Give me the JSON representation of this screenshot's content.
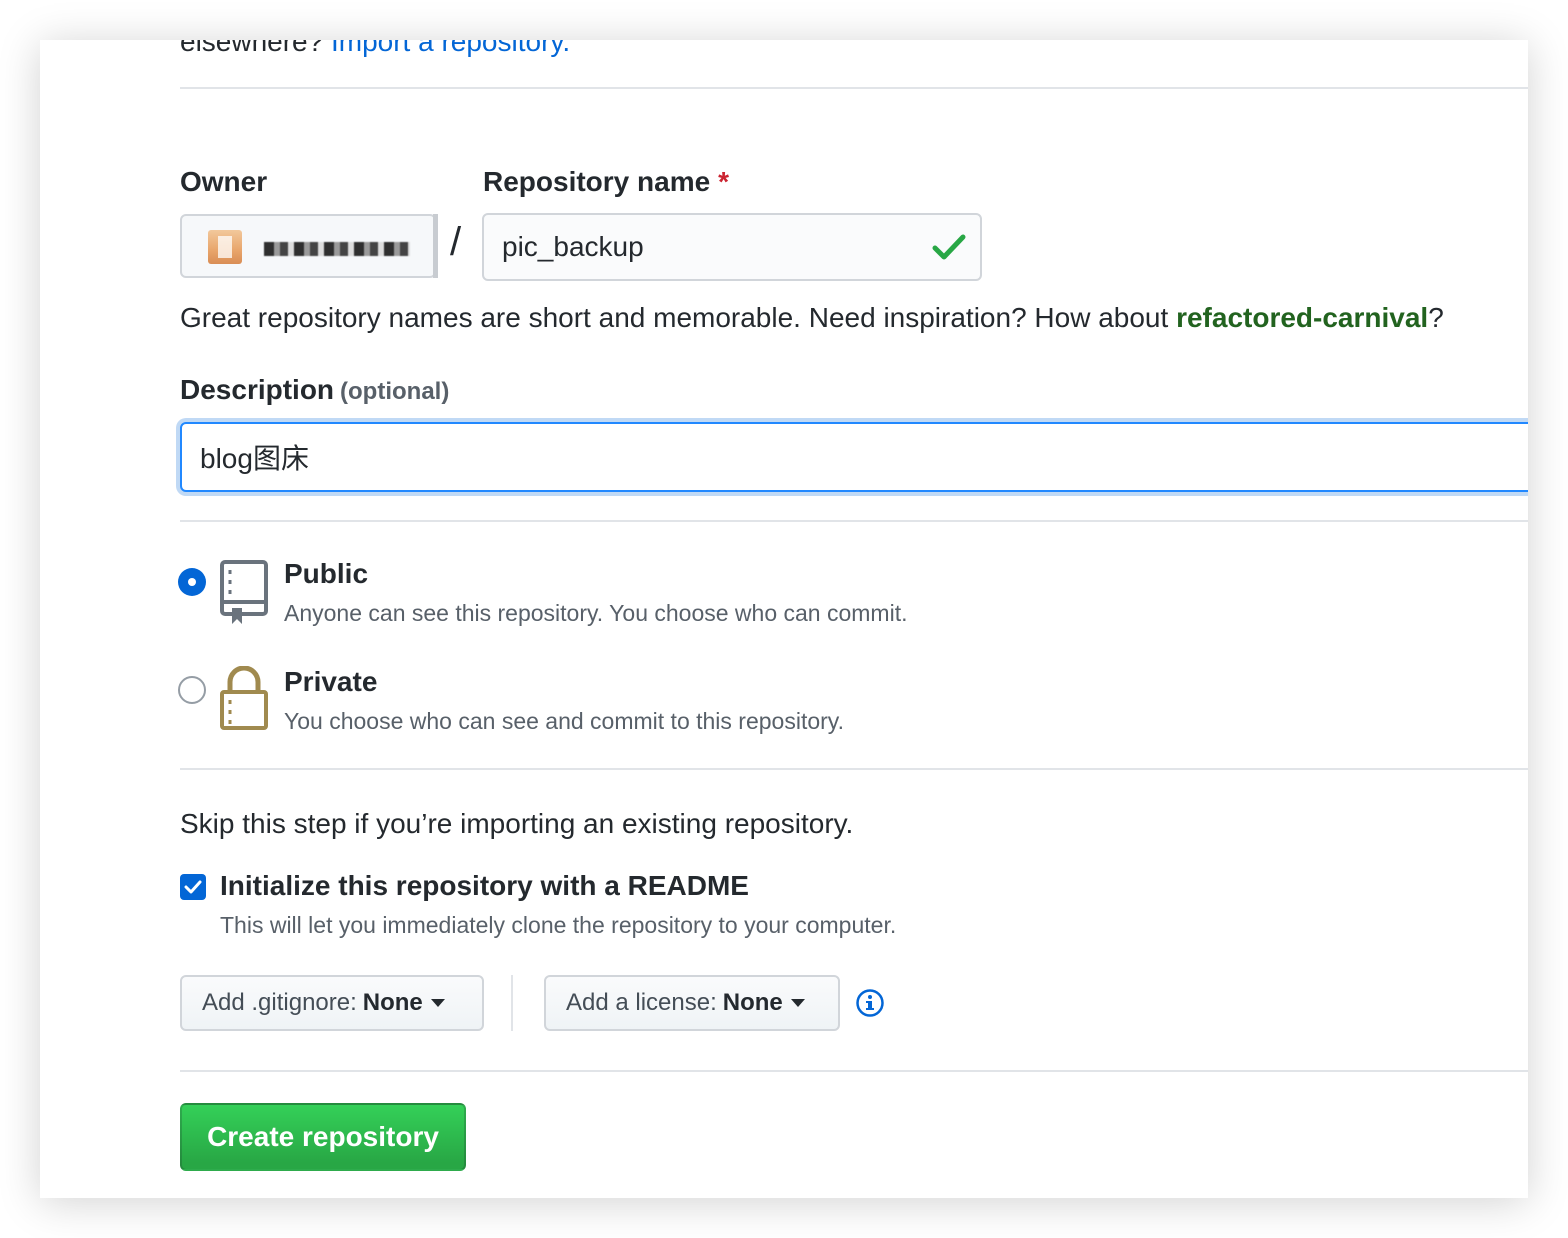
{
  "top_note": {
    "prefix": "elsewhere?",
    "link": "Import a repository."
  },
  "owner": {
    "label": "Owner",
    "username": "(blurred)"
  },
  "repo_name": {
    "label": "Repository name",
    "required_mark": "*",
    "value": "pic_backup"
  },
  "name_hint": {
    "text": "Great repository names are short and memorable. Need inspiration? How about ",
    "suggestion": "refactored-carnival",
    "suffix": "?"
  },
  "description": {
    "label": "Description",
    "optional": "(optional)",
    "value": "blog图床"
  },
  "visibility": {
    "public": {
      "title": "Public",
      "desc": "Anyone can see this repository. You choose who can commit.",
      "selected": true
    },
    "private": {
      "title": "Private",
      "desc": "You choose who can see and commit to this repository.",
      "selected": false
    }
  },
  "init": {
    "skip_text": "Skip this step if you’re importing an existing repository.",
    "readme_title": "Initialize this repository with a README",
    "readme_desc": "This will let you immediately clone the repository to your computer.",
    "readme_checked": true
  },
  "gitignore": {
    "prefix": "Add .gitignore:",
    "value": "None"
  },
  "license": {
    "prefix": "Add a license:",
    "value": "None"
  },
  "create_button": "Create repository",
  "colors": {
    "accent": "#0366d6",
    "success": "#28a745",
    "suggestion": "#22631f",
    "required": "#cb2431"
  }
}
